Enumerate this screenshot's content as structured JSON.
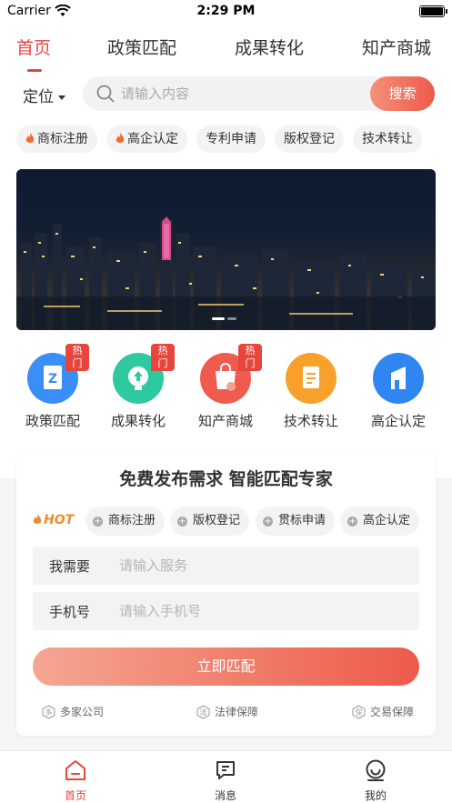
{
  "status_bar": {
    "carrier": "Carrier",
    "time": "2:29 PM"
  },
  "top_tabs": [
    "首页",
    "政策匹配",
    "成果转化",
    "知产商城"
  ],
  "location_label": "定位",
  "search": {
    "placeholder": "请输入内容",
    "button": "搜索"
  },
  "quick_chips": [
    {
      "label": "商标注册",
      "hot": true
    },
    {
      "label": "高企认定",
      "hot": true
    },
    {
      "label": "专利申请",
      "hot": false
    },
    {
      "label": "版权登记",
      "hot": false
    },
    {
      "label": "技术转让",
      "hot": false
    }
  ],
  "services": [
    {
      "label": "政策匹配",
      "badge": "热门",
      "color": "#3a8ef7",
      "icon": "document-z-icon"
    },
    {
      "label": "成果转化",
      "badge": "热门",
      "color": "#2ec9a1",
      "icon": "upload-bulb-icon"
    },
    {
      "label": "知产商城",
      "badge": "热门",
      "color": "#f05b4f",
      "icon": "shopping-bag-icon"
    },
    {
      "label": "技术转让",
      "badge": "",
      "color": "#f7a12a",
      "icon": "clipboard-icon"
    },
    {
      "label": "高企认定",
      "badge": "",
      "color": "#2f86f0",
      "icon": "building-icon"
    }
  ],
  "card": {
    "title": "免费发布需求  智能匹配专家",
    "hot_label": "HOT",
    "hot_chips": [
      "商标注册",
      "版权登记",
      "贯标申请",
      "高企认定"
    ],
    "need_label": "我需要",
    "need_placeholder": "请输入服务",
    "phone_label": "手机号",
    "phone_placeholder": "请输入手机号",
    "submit": "立即匹配",
    "guarantees": [
      {
        "badge": "多",
        "label": "多家公司"
      },
      {
        "badge": "法",
        "label": "法律保障"
      },
      {
        "badge": "保",
        "label": "交易保障"
      }
    ]
  },
  "tab_bar": [
    "首页",
    "消息",
    "我的"
  ],
  "accent_color": "#e8453c"
}
